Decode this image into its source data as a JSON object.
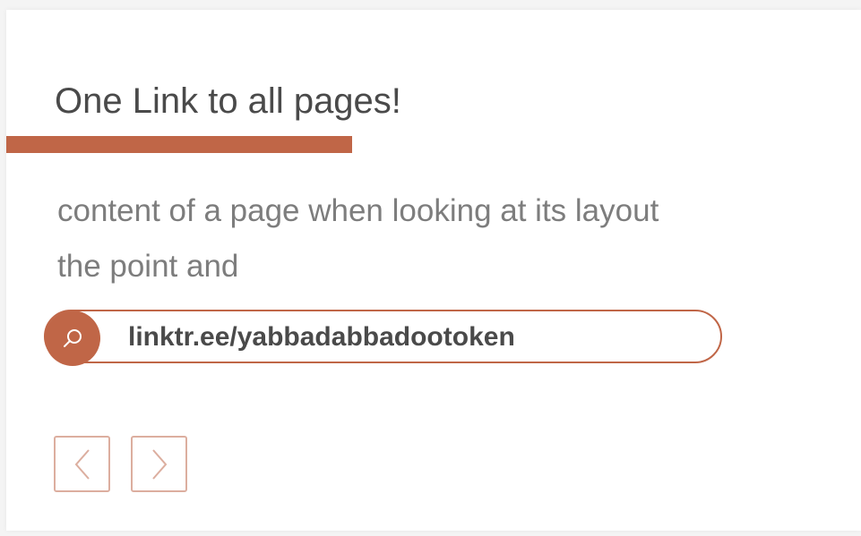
{
  "card": {
    "title": "One Link to all pages!",
    "description_lines": [
      "content of a page when looking at its layout",
      "the point and"
    ],
    "link": {
      "text": "linktr.ee/yabbadabbadootoken",
      "icon": "search-icon"
    },
    "navigation": {
      "prev_icon": "chevron-left-icon",
      "next_icon": "chevron-right-icon"
    }
  },
  "colors": {
    "accent": "#c06647",
    "accent_light": "#dcae9f",
    "title_text": "#4a4a4a",
    "body_text": "#7d7d7d",
    "background": "#f4f4f4",
    "card": "#ffffff"
  }
}
